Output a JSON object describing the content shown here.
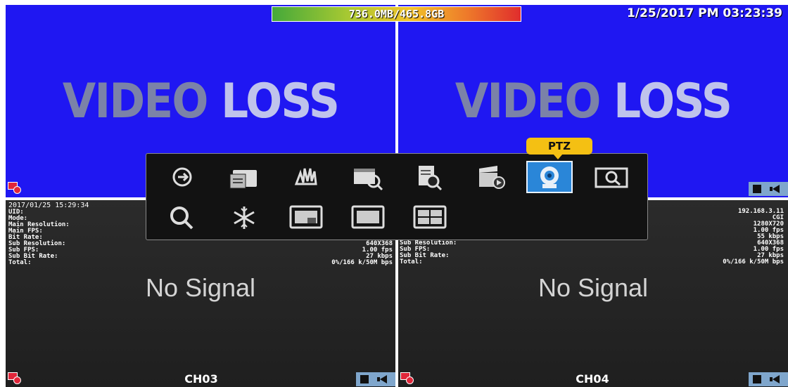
{
  "status": {
    "hdd_usage": "736.0MB/465.8GB",
    "datetime": "1/25/2017 PM 03:23:39"
  },
  "channels": {
    "ch1": {
      "message_a": "VIDEO",
      "message_b": "LOSS"
    },
    "ch2": {
      "message_a": "VIDEO",
      "message_b": "LOSS"
    },
    "ch3": {
      "label": "CH03",
      "message": "No Signal",
      "timestamp": "2017/01/25 15:29:34",
      "info": [
        {
          "k": "UID:",
          "v": ""
        },
        {
          "k": "Mode:",
          "v": ""
        },
        {
          "k": "Main Resolution:",
          "v": ""
        },
        {
          "k": "Main FPS:",
          "v": ""
        },
        {
          "k": "Bit Rate:",
          "v": ""
        },
        {
          "k": "Sub Resolution:",
          "v": "640X368"
        },
        {
          "k": "Sub FPS:",
          "v": "1.00 fps"
        },
        {
          "k": "Sub Bit Rate:",
          "v": "27 kbps"
        },
        {
          "k": "Total:",
          "v": "0%/166 k/50M bps"
        }
      ]
    },
    "ch4": {
      "label": "CH04",
      "message": "No Signal",
      "info": [
        {
          "k": "",
          "v": "192.168.3.11"
        },
        {
          "k": "",
          "v": "CGI"
        },
        {
          "k": "",
          "v": "1280X720"
        },
        {
          "k": "",
          "v": "1.00 fps"
        },
        {
          "k": "",
          "v": "55 kbps"
        },
        {
          "k": "Sub Resolution:",
          "v": "640X368"
        },
        {
          "k": "Sub FPS:",
          "v": "1.00 fps"
        },
        {
          "k": "Sub Bit Rate:",
          "v": "27 kbps"
        },
        {
          "k": "Total:",
          "v": "0%/166 k/50M bps"
        }
      ]
    }
  },
  "menu": {
    "tooltip": "PTZ",
    "selected": "ptz",
    "items_row1": [
      "sequence-icon",
      "file-folder-icon",
      "hand-drag-icon",
      "schedule-search-icon",
      "event-search-icon",
      "playback-icon",
      "ptz-camera-icon",
      "zoom-search-icon"
    ],
    "items_row2": [
      "search-icon",
      "freeze-icon",
      "pip-view-icon",
      "single-view-icon",
      "quad-view-icon"
    ]
  },
  "colors": {
    "video_loss_bg": "#1f17f2",
    "no_signal_bg": "#262626",
    "menu_bg": "#121212",
    "selected_bg": "#2a86d8",
    "tooltip_bg": "#f4c013"
  }
}
